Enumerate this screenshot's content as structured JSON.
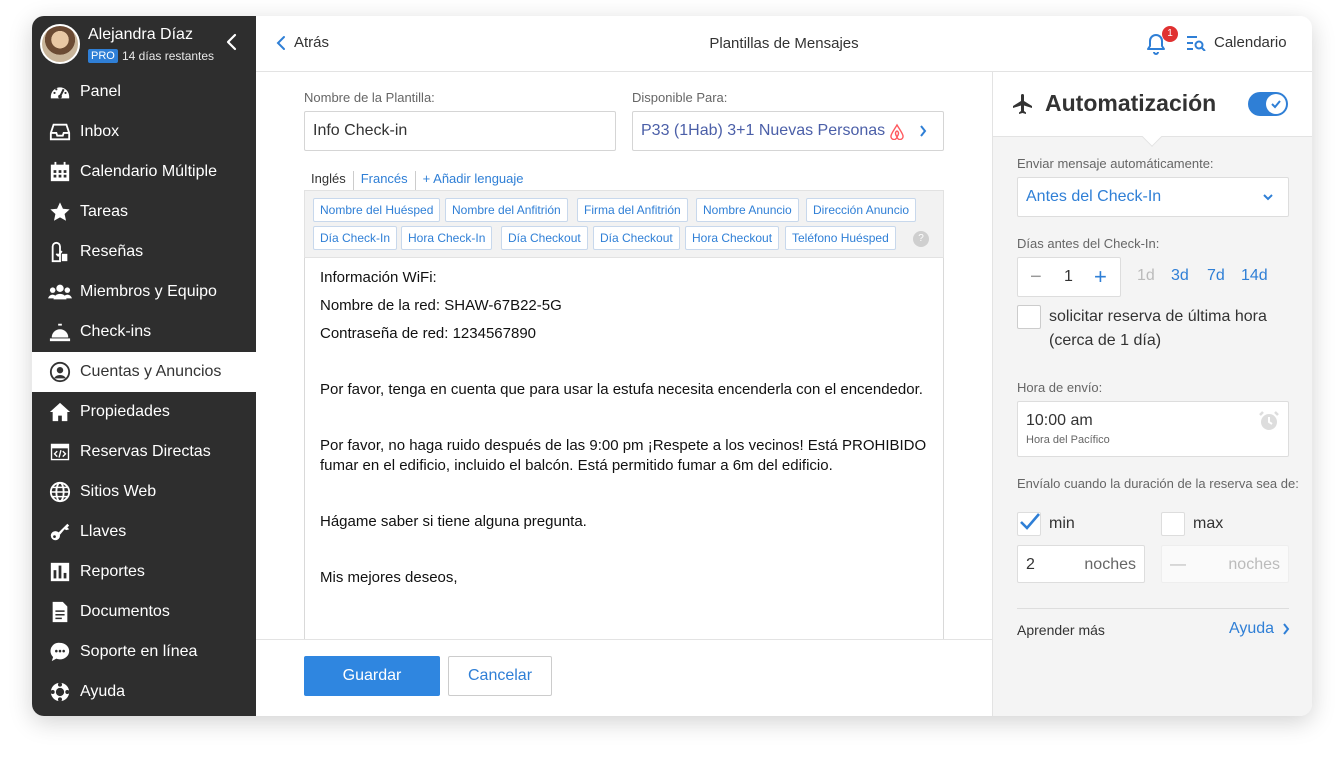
{
  "profile": {
    "name": "Alejandra Díaz",
    "plan_badge": "PRO",
    "trial_text": "14 días restantes"
  },
  "sidebar": {
    "items": [
      {
        "label": "Panel",
        "icon": "dashboard-icon"
      },
      {
        "label": "Inbox",
        "icon": "inbox-icon"
      },
      {
        "label": "Calendario Múltiple",
        "icon": "calendar-grid-icon"
      },
      {
        "label": "Tareas",
        "icon": "star-icon"
      },
      {
        "label": "Reseñas",
        "icon": "reviews-icon"
      },
      {
        "label": "Miembros y Equipo",
        "icon": "team-icon"
      },
      {
        "label": "Check-ins",
        "icon": "service-bell-icon"
      },
      {
        "label": "Cuentas y Anuncios",
        "icon": "account-circle-icon"
      },
      {
        "label": "Propiedades",
        "icon": "home-icon"
      },
      {
        "label": "Reservas Directas",
        "icon": "code-window-icon"
      },
      {
        "label": "Sitios Web",
        "icon": "globe-icon"
      },
      {
        "label": "Llaves",
        "icon": "key-icon"
      },
      {
        "label": "Reportes",
        "icon": "bar-chart-icon"
      },
      {
        "label": "Documentos",
        "icon": "document-icon"
      },
      {
        "label": "Soporte en línea",
        "icon": "chat-icon"
      },
      {
        "label": "Ayuda",
        "icon": "lifebuoy-icon"
      }
    ],
    "active_index": 7
  },
  "header": {
    "back_label": "Atrás",
    "title": "Plantillas de Mensajes",
    "notification_count": "1",
    "calendar_label": "Calendario"
  },
  "form": {
    "name_label": "Nombre de la Plantilla:",
    "name_value": "Info Check-in",
    "available_label": "Disponible Para:",
    "available_value": "P33 (1Hab) 3+1 Nuevas Personas"
  },
  "languages": {
    "active": "Inglés",
    "other": "Francés",
    "add": "+ Añadir lenguaje"
  },
  "tags": [
    "Nombre del Huésped",
    "Nombre del Anfitrión",
    "Firma del Anfitrión",
    "Nombre Anuncio",
    "Dirección Anuncio",
    "Día Check-In",
    "Hora Check-In",
    "Día Checkout",
    "Día Checkout",
    "Hora Checkout",
    "Teléfono Huésped"
  ],
  "tags_help": "?",
  "message": [
    "Información WiFi:",
    "Nombre de la red: SHAW-67B22-5G",
    "Contraseña de red: 1234567890",
    "",
    "Por favor, tenga en cuenta que para usar la estufa necesita encenderla con el encendedor.",
    "",
    "Por favor, no haga ruido después de las 9:00 pm ¡Respete a los vecinos! Está PROHIBIDO fumar en el edificio, incluido el balcón. Está permitido fumar a 6m del edificio.",
    "",
    "Hágame saber si tiene alguna pregunta.",
    "",
    "Mis mejores deseos,"
  ],
  "buttons": {
    "save": "Guardar",
    "cancel": "Cancelar"
  },
  "automation": {
    "title": "Automatización",
    "enabled": true,
    "send_label": "Enviar mensaje automáticamente:",
    "send_value": "Antes del Check-In",
    "days_label": "Días antes del Check-In:",
    "days_value": "1",
    "minus": "−",
    "plus": "+",
    "quick_days": [
      "1d",
      "3d",
      "7d",
      "14d"
    ],
    "last_minute_line1": "solicitar reserva de última hora",
    "last_minute_line2": "(cerca de 1 día)",
    "send_time_label": "Hora de envío:",
    "send_time_value": "10:00 am",
    "timezone": "Hora del Pacífico",
    "duration_label": "Envíalo cuando la duración de la reserva sea de:",
    "min_label": "min",
    "max_label": "max",
    "min_checked": true,
    "max_checked": false,
    "min_nights": "2",
    "max_nights": "—",
    "nights_unit": "noches",
    "learn_more": "Aprender más",
    "help_link": "Ayuda"
  },
  "colors": {
    "sidebar_bg": "#2e2e2e",
    "accent": "#2f7fd6",
    "badge": "#e03131",
    "airbnb": "#ff5a5f"
  }
}
